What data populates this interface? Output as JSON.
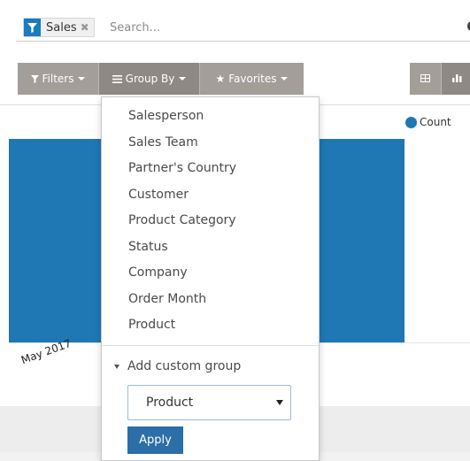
{
  "search": {
    "facet_label": "Sales",
    "facet_icon": "funnel-icon",
    "remove_icon": "✖",
    "placeholder": "Search...",
    "more_icon": "Ө"
  },
  "toolbar": {
    "filters_label": "Filters",
    "groupby_label": "Group By",
    "favorites_label": "Favorites",
    "button_color": "#a39e98"
  },
  "dropdown": {
    "items": [
      {
        "label": "Salesperson"
      },
      {
        "label": "Sales Team"
      },
      {
        "label": "Partner's Country"
      },
      {
        "label": "Customer"
      },
      {
        "label": "Product Category"
      },
      {
        "label": "Status"
      },
      {
        "label": "Company"
      },
      {
        "label": "Order Month"
      },
      {
        "label": "Product"
      }
    ],
    "custom_group_label": "Add custom group",
    "custom_group_selected": "Product",
    "apply_label": "Apply"
  },
  "graph": {
    "legend_label": "Count",
    "series_color": "#1f77b4",
    "x_tick": "May 2017"
  }
}
